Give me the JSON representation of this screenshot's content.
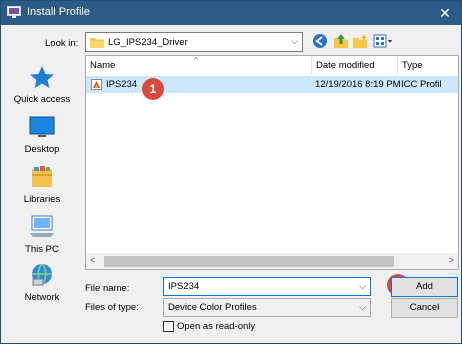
{
  "window": {
    "title": "Install Profile",
    "close_glyph": "✕"
  },
  "toolbar": {
    "look_in_label": "Look in:",
    "look_in_value": "LG_IPS234_Driver",
    "chevron": "⌵",
    "icons": [
      "back-arrow-icon",
      "up-folder-icon",
      "new-folder-icon",
      "view-menu-icon"
    ]
  },
  "places": [
    {
      "label": "Quick access",
      "icon": "star-icon"
    },
    {
      "label": "Desktop",
      "icon": "desktop-icon"
    },
    {
      "label": "Libraries",
      "icon": "libraries-icon"
    },
    {
      "label": "This PC",
      "icon": "computer-icon"
    },
    {
      "label": "Network",
      "icon": "network-icon"
    }
  ],
  "filelist": {
    "columns": {
      "name": "Name",
      "date_modified": "Date modified",
      "type": "Type"
    },
    "sort_glyph": "^",
    "rows": [
      {
        "name": "IPS234",
        "date_modified": "12/19/2016 8:19 PM",
        "type": "ICC Profil"
      }
    ],
    "scroll_left": "<",
    "scroll_right": ">"
  },
  "annotations": {
    "badge1": "1",
    "badge2": "2"
  },
  "form": {
    "file_name_label": "File name:",
    "file_name_value": "IPS234",
    "files_of_type_label": "Files of type:",
    "files_of_type_value": "Device Color Profiles",
    "open_readonly_label": "Open as read-only"
  },
  "buttons": {
    "add": "Add",
    "cancel": "Cancel"
  },
  "colors": {
    "title_bar": "#2b5b86",
    "selection": "#cce8ff",
    "badge": "#d94a3e",
    "focus": "#0078d7"
  }
}
